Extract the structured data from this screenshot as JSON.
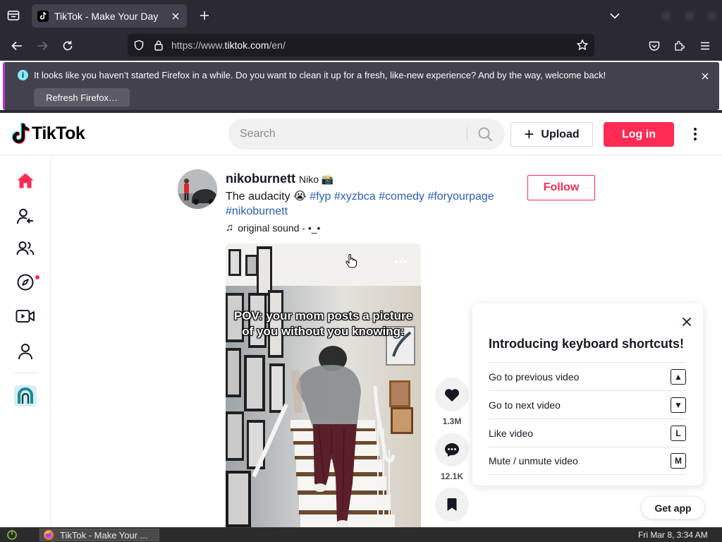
{
  "browser": {
    "tab_title": "TikTok - Make Your Day",
    "url_scheme": "https://www.",
    "url_host": "tiktok.com",
    "url_path": "/en/",
    "notification": {
      "message": "It looks like you haven’t started Firefox in a while. Do you want to clean it up for a fresh, like-new experience? And by the way, welcome back!",
      "info_glyph": "i",
      "button_label": "Refresh Firefox…"
    }
  },
  "header": {
    "logo_text": "TikTok",
    "search_placeholder": "Search",
    "upload_label": "Upload",
    "login_label": "Log in"
  },
  "sidebar": {
    "items": [
      {
        "name": "For You",
        "icon": "home-icon",
        "active": true
      },
      {
        "name": "Following",
        "icon": "following-icon"
      },
      {
        "name": "Friends",
        "icon": "friends-icon"
      },
      {
        "name": "Explore",
        "icon": "explore-icon"
      },
      {
        "name": "LIVE",
        "icon": "live-icon"
      },
      {
        "name": "Profile",
        "icon": "profile-icon"
      }
    ]
  },
  "post": {
    "username": "nikoburnett",
    "nickname": "Niko 📸",
    "caption_text": "The audacity 😭",
    "hashtags": [
      "#fyp",
      "#xyzbca",
      "#comedy",
      "#foryourpage",
      "#nikoburnett"
    ],
    "sound": "original sound - •_•",
    "follow_label": "Follow",
    "overlay_text": "POV: your mom posts a picture of you without you knowing:",
    "more_glyph": "•••",
    "likes": "1.3M",
    "comments": "12.1K"
  },
  "shortcuts": {
    "title": "Introducing keyboard shortcuts!",
    "rows": [
      {
        "label": "Go to previous video",
        "key": "▲"
      },
      {
        "label": "Go to next video",
        "key": "▼"
      },
      {
        "label": "Like video",
        "key": "L"
      },
      {
        "label": "Mute / unmute video",
        "key": "M"
      }
    ]
  },
  "get_app_label": "Get app",
  "taskbar": {
    "task_label": "TikTok - Make Your ...",
    "clock": "Fri Mar  8,  3:34 AM"
  },
  "colors": {
    "accent": "#fe2c55",
    "hashtag": "#2b5db9",
    "chrome_bg": "#2b2a33"
  }
}
